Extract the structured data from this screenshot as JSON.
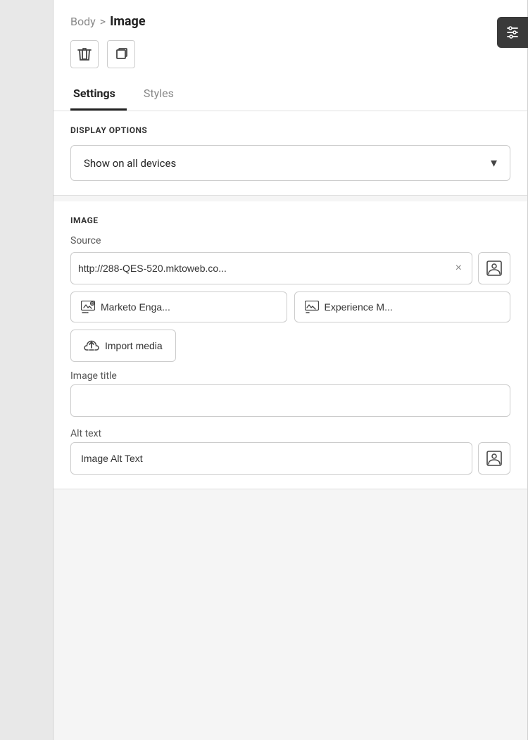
{
  "breadcrumb": {
    "parent": "Body",
    "separator": ">",
    "current": "Image"
  },
  "toolbar": {
    "delete_label": "🗑",
    "duplicate_label": "⊞"
  },
  "tabs": [
    {
      "label": "Settings",
      "active": true
    },
    {
      "label": "Styles",
      "active": false
    }
  ],
  "display_options": {
    "section_title": "DISPLAY OPTIONS",
    "dropdown_value": "Show on all devices",
    "chevron": "▾"
  },
  "image_section": {
    "section_title": "IMAGE",
    "source_label": "Source",
    "source_value": "http://288-QES-520.mktoweb.co...",
    "clear_icon": "×",
    "marketo_btn": "Marketo Enga...",
    "experience_btn": "Experience M...",
    "import_btn": "Import media",
    "image_title_label": "Image title",
    "image_title_value": "",
    "image_title_placeholder": "",
    "alt_text_label": "Alt text",
    "alt_text_value": "Image Alt Text"
  },
  "fab": {
    "icon": "⚙"
  }
}
